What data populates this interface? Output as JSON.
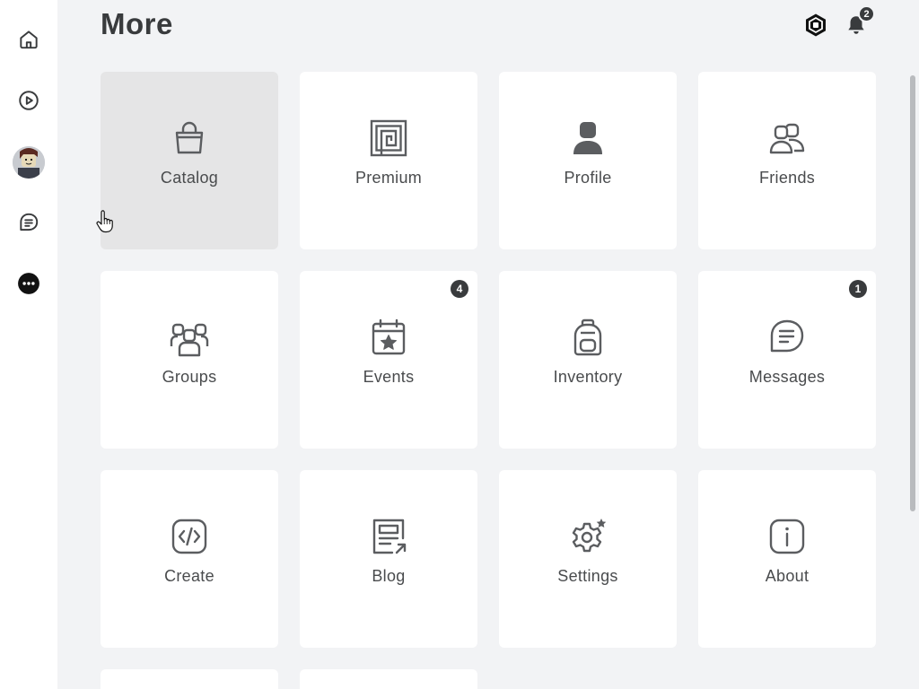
{
  "header": {
    "title": "More",
    "notification_count": "2"
  },
  "sidebar": {
    "items": [
      {
        "name": "home",
        "icon": "home-icon"
      },
      {
        "name": "discover",
        "icon": "play-icon"
      },
      {
        "name": "avatar",
        "icon": "avatar"
      },
      {
        "name": "chat",
        "icon": "chat-icon"
      },
      {
        "name": "more",
        "icon": "more-icon"
      }
    ]
  },
  "tiles": [
    {
      "label": "Catalog",
      "icon": "shopping-bag-icon",
      "badge": ""
    },
    {
      "label": "Premium",
      "icon": "premium-icon",
      "badge": ""
    },
    {
      "label": "Profile",
      "icon": "profile-icon",
      "badge": ""
    },
    {
      "label": "Friends",
      "icon": "friends-icon",
      "badge": ""
    },
    {
      "label": "Groups",
      "icon": "groups-icon",
      "badge": ""
    },
    {
      "label": "Events",
      "icon": "calendar-star-icon",
      "badge": "4"
    },
    {
      "label": "Inventory",
      "icon": "backpack-icon",
      "badge": ""
    },
    {
      "label": "Messages",
      "icon": "message-icon",
      "badge": "1"
    },
    {
      "label": "Create",
      "icon": "code-icon",
      "badge": ""
    },
    {
      "label": "Blog",
      "icon": "blog-icon",
      "badge": ""
    },
    {
      "label": "Settings",
      "icon": "gear-icon",
      "badge": ""
    },
    {
      "label": "About",
      "icon": "info-icon",
      "badge": ""
    }
  ]
}
